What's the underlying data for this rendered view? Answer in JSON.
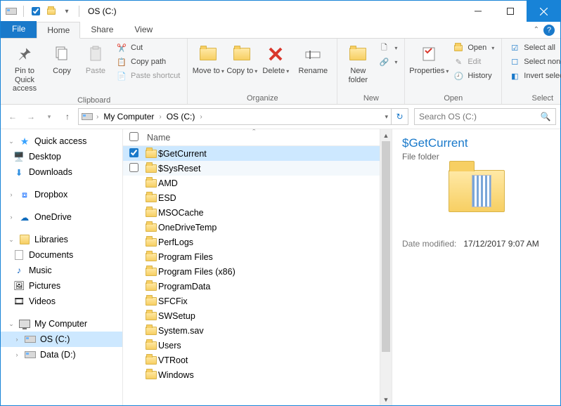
{
  "window": {
    "title": "OS (C:)"
  },
  "tabs": {
    "file": "File",
    "home": "Home",
    "share": "Share",
    "view": "View"
  },
  "ribbon": {
    "clipboard": {
      "label": "Clipboard",
      "pin": "Pin to Quick access",
      "copy": "Copy",
      "paste": "Paste",
      "cut": "Cut",
      "copy_path": "Copy path",
      "paste_shortcut": "Paste shortcut"
    },
    "organize": {
      "label": "Organize",
      "move": "Move to",
      "copy": "Copy to",
      "delete": "Delete",
      "rename": "Rename"
    },
    "new": {
      "label": "New",
      "folder": "New folder"
    },
    "open": {
      "label": "Open",
      "properties": "Properties",
      "open": "Open",
      "edit": "Edit",
      "history": "History"
    },
    "select": {
      "label": "Select",
      "all": "Select all",
      "none": "Select none",
      "invert": "Invert selection"
    }
  },
  "breadcrumb": {
    "b1": "My Computer",
    "b2": "OS (C:)"
  },
  "search": {
    "placeholder": "Search OS (C:)"
  },
  "tree": {
    "quick": "Quick access",
    "desktop": "Desktop",
    "downloads": "Downloads",
    "dropbox": "Dropbox",
    "onedrive": "OneDrive",
    "libraries": "Libraries",
    "documents": "Documents",
    "music": "Music",
    "pictures": "Pictures",
    "videos": "Videos",
    "mycomputer": "My Computer",
    "osc": "OS (C:)",
    "datad": "Data (D:)"
  },
  "columns": {
    "name": "Name"
  },
  "items": {
    "i0": "$GetCurrent",
    "i1": "$SysReset",
    "i2": "AMD",
    "i3": "ESD",
    "i4": "MSOCache",
    "i5": "OneDriveTemp",
    "i6": "PerfLogs",
    "i7": "Program Files",
    "i8": "Program Files (x86)",
    "i9": "ProgramData",
    "i10": "SFCFix",
    "i11": "SWSetup",
    "i12": "System.sav",
    "i13": "Users",
    "i14": "VTRoot",
    "i15": "Windows"
  },
  "details": {
    "title": "$GetCurrent",
    "type": "File folder",
    "date_label": "Date modified:",
    "date_value": "17/12/2017 9:07 AM"
  }
}
